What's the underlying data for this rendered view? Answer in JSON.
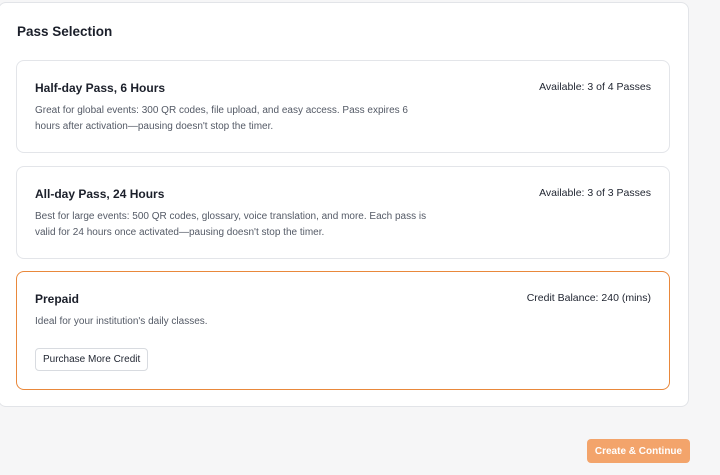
{
  "section": {
    "title": "Pass Selection"
  },
  "passes": [
    {
      "title": "Half-day Pass, 6 Hours",
      "meta": "Available: 3 of 4 Passes",
      "description": "Great for global events: 300 QR codes, file upload, and easy access. Pass expires 6 hours after activation—pausing doesn't stop the timer."
    },
    {
      "title": "All-day Pass, 24 Hours",
      "meta": "Available: 3 of 3 Passes",
      "description": "Best for large events: 500 QR codes, glossary, voice translation, and more. Each pass is valid for 24 hours once activated—pausing doesn't stop the timer."
    },
    {
      "title": "Prepaid",
      "meta": "Credit Balance: 240 (mins)",
      "description": "Ideal for your institution's daily classes.",
      "action_label": "Purchase More Credit",
      "selected": true
    }
  ],
  "footer": {
    "continue_label": "Create & Continue"
  },
  "colors": {
    "accent": "#e9883b",
    "primary_button": "#f3a46b"
  }
}
